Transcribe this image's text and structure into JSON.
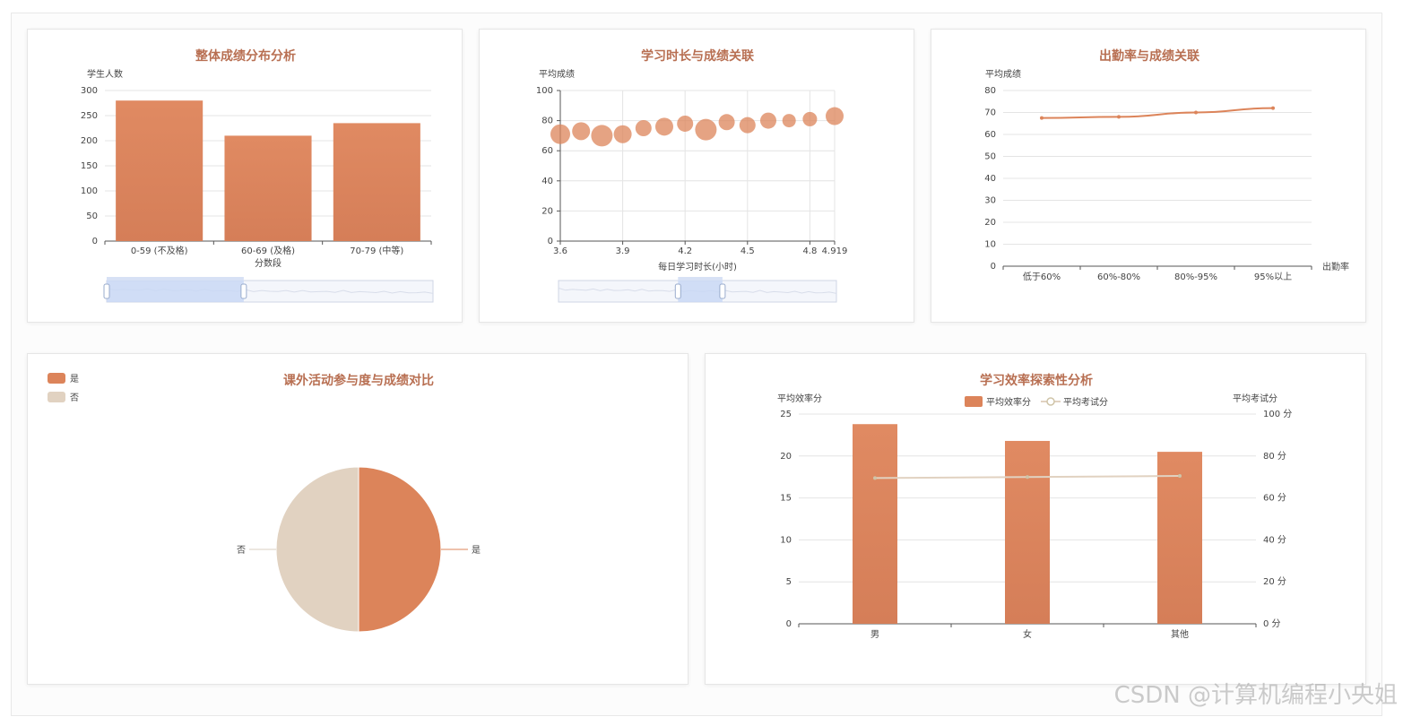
{
  "colors": {
    "primary": "#dc845a",
    "secondary": "#e1d2c1",
    "title": "#b86f52",
    "zoom_fill": "#c9d8f5"
  },
  "watermark": "CSDN @计算机编程小央姐",
  "chart_data": [
    {
      "type": "bar",
      "title": "整体成绩分布分析",
      "xlabel": "分数段",
      "ylabel": "学生人数",
      "categories": [
        "0-59 (不及格)",
        "60-69 (及格)",
        "70-79 (中等)"
      ],
      "values": [
        280,
        210,
        235
      ],
      "ylim": [
        0,
        300
      ],
      "yticks": [
        "0",
        "50",
        "100",
        "150",
        "200",
        "250",
        "300"
      ],
      "grid": true,
      "dataZoom": {
        "start": 0,
        "end": 0.42
      }
    },
    {
      "type": "scatter",
      "title": "学习时长与成绩关联",
      "xlabel": "每日学习时长(小时)",
      "ylabel": "平均成绩",
      "xlim": [
        3.6,
        4.919
      ],
      "ylim": [
        0,
        100
      ],
      "xticks": [
        "3.6",
        "3.9",
        "4.2",
        "4.5",
        "4.8",
        "4.919"
      ],
      "yticks": [
        "0",
        "20",
        "40",
        "60",
        "80",
        "100"
      ],
      "points": [
        {
          "x": 3.6,
          "y": 71,
          "size": 22
        },
        {
          "x": 3.7,
          "y": 73,
          "size": 20
        },
        {
          "x": 3.8,
          "y": 70,
          "size": 24
        },
        {
          "x": 3.9,
          "y": 71,
          "size": 20
        },
        {
          "x": 4.0,
          "y": 75,
          "size": 18
        },
        {
          "x": 4.1,
          "y": 76,
          "size": 20
        },
        {
          "x": 4.2,
          "y": 78,
          "size": 18
        },
        {
          "x": 4.3,
          "y": 74,
          "size": 24
        },
        {
          "x": 4.4,
          "y": 79,
          "size": 18
        },
        {
          "x": 4.5,
          "y": 77,
          "size": 18
        },
        {
          "x": 4.6,
          "y": 80,
          "size": 18
        },
        {
          "x": 4.7,
          "y": 80,
          "size": 15
        },
        {
          "x": 4.8,
          "y": 81,
          "size": 16
        },
        {
          "x": 4.919,
          "y": 83,
          "size": 20
        }
      ],
      "grid": true,
      "dataZoom": {
        "start": 0.43,
        "end": 0.59
      }
    },
    {
      "type": "line",
      "title": "出勤率与成绩关联",
      "xlabel": "出勤率",
      "ylabel": "平均成绩",
      "categories": [
        "低于60%",
        "60%-80%",
        "80%-95%",
        "95%以上"
      ],
      "values": [
        67.5,
        68,
        70,
        72
      ],
      "ylim": [
        0,
        80
      ],
      "yticks": [
        "0",
        "10",
        "20",
        "30",
        "40",
        "50",
        "60",
        "70",
        "80"
      ],
      "grid": true
    },
    {
      "type": "pie",
      "title": "课外活动参与度与成绩对比",
      "legend": [
        "是",
        "否"
      ],
      "legend_position": "top-left",
      "slices": [
        {
          "name": "是",
          "value": 50
        },
        {
          "name": "否",
          "value": 50
        }
      ]
    },
    {
      "type": "bar",
      "title": "学习效率探索性分析",
      "legend": [
        "平均效率分",
        "平均考试分"
      ],
      "legend_position": "top-center",
      "ylabel": "平均效率分",
      "ylabel_right": "平均考试分",
      "categories": [
        "男",
        "女",
        "其他"
      ],
      "series": [
        {
          "name": "平均效率分",
          "type": "bar",
          "axis": "left",
          "values": [
            23.8,
            21.8,
            20.5
          ]
        },
        {
          "name": "平均考试分",
          "type": "line",
          "axis": "right",
          "values": [
            69.5,
            70.0,
            70.5
          ]
        }
      ],
      "ylim": [
        0,
        25
      ],
      "ylim_right": [
        0,
        100
      ],
      "yticks": [
        "0",
        "5",
        "10",
        "15",
        "20",
        "25"
      ],
      "yticks_right": [
        "0 分",
        "20 分",
        "40 分",
        "60 分",
        "80 分",
        "100 分"
      ],
      "grid": true
    }
  ]
}
